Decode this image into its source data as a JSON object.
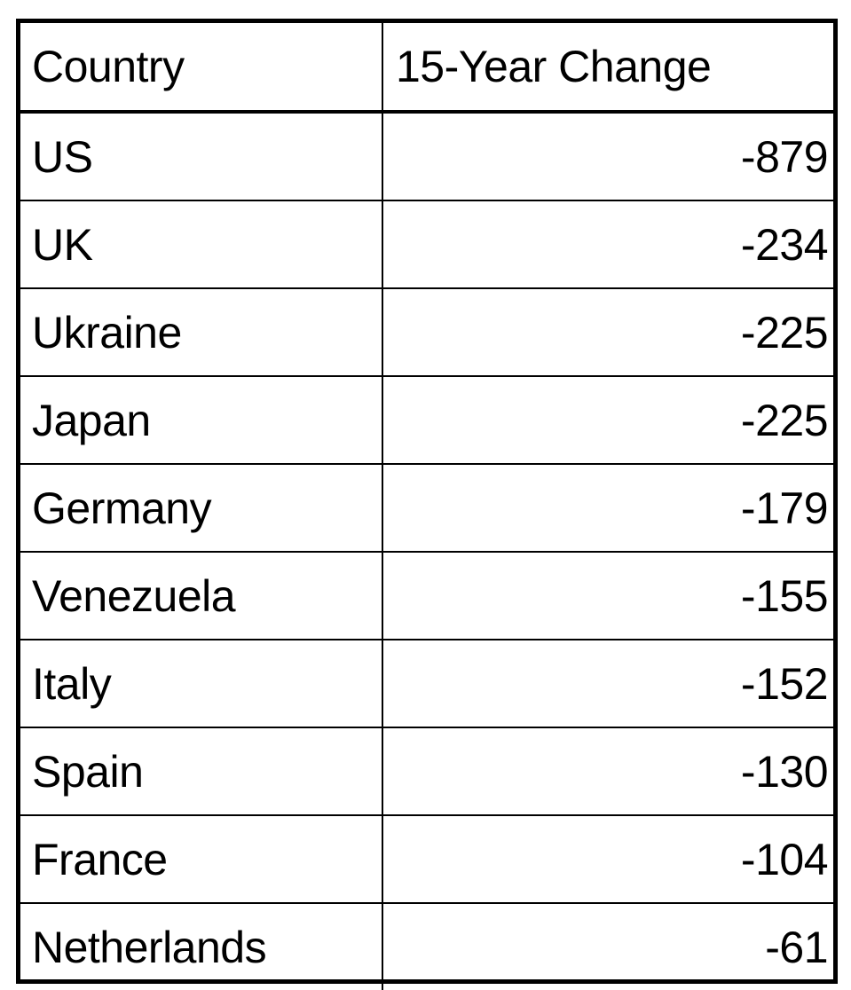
{
  "table": {
    "headers": [
      "Country",
      "15-Year Change"
    ],
    "rows": [
      {
        "country": "US",
        "change": "-879"
      },
      {
        "country": "UK",
        "change": "-234"
      },
      {
        "country": "Ukraine",
        "change": "-225"
      },
      {
        "country": "Japan",
        "change": "-225"
      },
      {
        "country": "Germany",
        "change": "-179"
      },
      {
        "country": "Venezuela",
        "change": "-155"
      },
      {
        "country": "Italy",
        "change": "-152"
      },
      {
        "country": "Spain",
        "change": "-130"
      },
      {
        "country": "France",
        "change": "-104"
      },
      {
        "country": "Netherlands",
        "change": "-61"
      }
    ]
  }
}
